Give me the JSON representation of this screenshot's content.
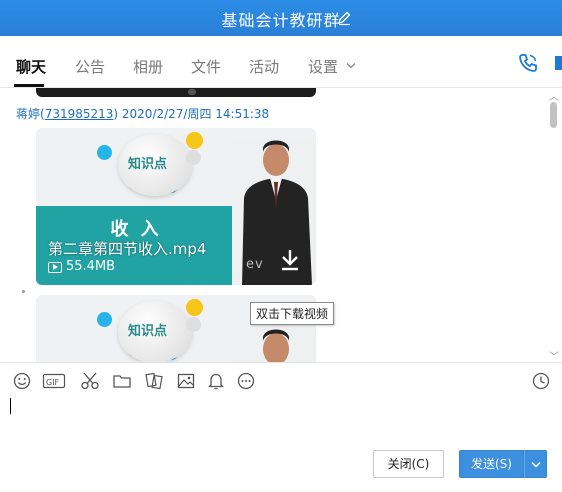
{
  "window": {
    "title": "基础会计教研群"
  },
  "tabs": [
    {
      "label": "聊天",
      "active": true
    },
    {
      "label": "公告"
    },
    {
      "label": "相册"
    },
    {
      "label": "文件"
    },
    {
      "label": "活动"
    },
    {
      "label": "设置"
    }
  ],
  "message": {
    "sender_name": "蒋婷(",
    "sender_qq": "731985213",
    "sender_rest": ") 2020/2/27/周四 14:51:38"
  },
  "videos": [
    {
      "thumb_badge": "知识点",
      "panel_title": "收 入",
      "filename": "第二章第四节收入.mp4",
      "size": "55.4MB",
      "watermark": "ev"
    },
    {
      "thumb_badge": "知识点"
    }
  ],
  "tooltip": {
    "text": "双击下载视频"
  },
  "buttons": {
    "close": "关闭(C)",
    "send": "发送(S)"
  },
  "colors": {
    "titlebar": "#2a86e0",
    "link": "#1f6fc5",
    "accent": "#3d8fe0",
    "teal_panel": "#21a3a4"
  }
}
